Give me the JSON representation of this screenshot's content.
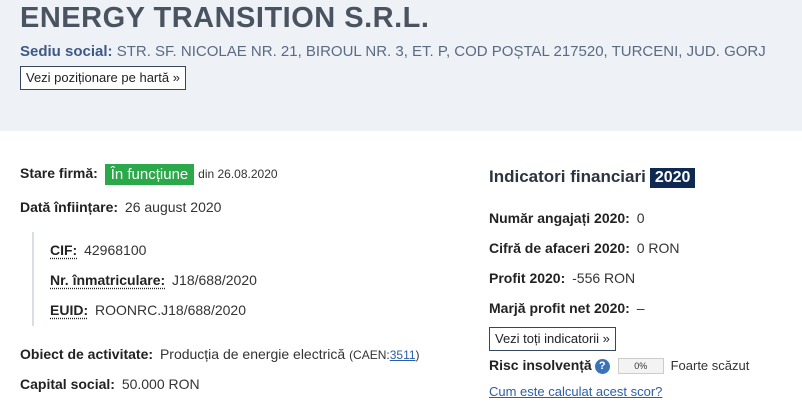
{
  "company": {
    "name": "ENERGY TRANSITION S.R.L."
  },
  "address": {
    "label": "Sediu social:",
    "value": "STR. SF. NICOLAE NR. 21, BIROUL NR. 3, ET. P, COD POȘTAL 217520, TURCENI, JUD. GORJ",
    "map_button": "Vezi poziționare pe hartă »"
  },
  "status": {
    "label": "Stare firmă:",
    "badge": "În funcțiune",
    "since": "din 26.08.2020",
    "badge_color": "#2aa84a"
  },
  "founded": {
    "label": "Dată înființare:",
    "value": "26 august 2020"
  },
  "identifiers": {
    "cif_label": "CIF:",
    "cif_value": "42968100",
    "reg_label": "Nr. înmatriculare:",
    "reg_value": "J18/688/2020",
    "euid_label": "EUID:",
    "euid_value": "ROONRC.J18/688/2020"
  },
  "activity": {
    "label": "Obiect de activitate:",
    "value": "Producția de energie electrică",
    "caen_prefix": "(CAEN:",
    "caen_code": "3511",
    "caen_suffix": ")"
  },
  "capital": {
    "label": "Capital social:",
    "value": "50.000 RON"
  },
  "indicators": {
    "title": "Indicatori financiari",
    "year": "2020",
    "employees_label": "Număr angajați 2020:",
    "employees_value": "0",
    "turnover_label": "Cifră de afaceri 2020:",
    "turnover_value": "0 RON",
    "profit_label": "Profit 2020:",
    "profit_value": "-556 RON",
    "margin_label": "Marjă profit net 2020:",
    "margin_value": "–",
    "all_button": "Vezi toți indicatorii »",
    "risk_label": "Risc insolvență",
    "risk_help": "?",
    "risk_percent_text": "0%",
    "risk_percent": 0,
    "risk_level": "Foarte scăzut",
    "score_link": "Cum este calculat acest scor?"
  }
}
